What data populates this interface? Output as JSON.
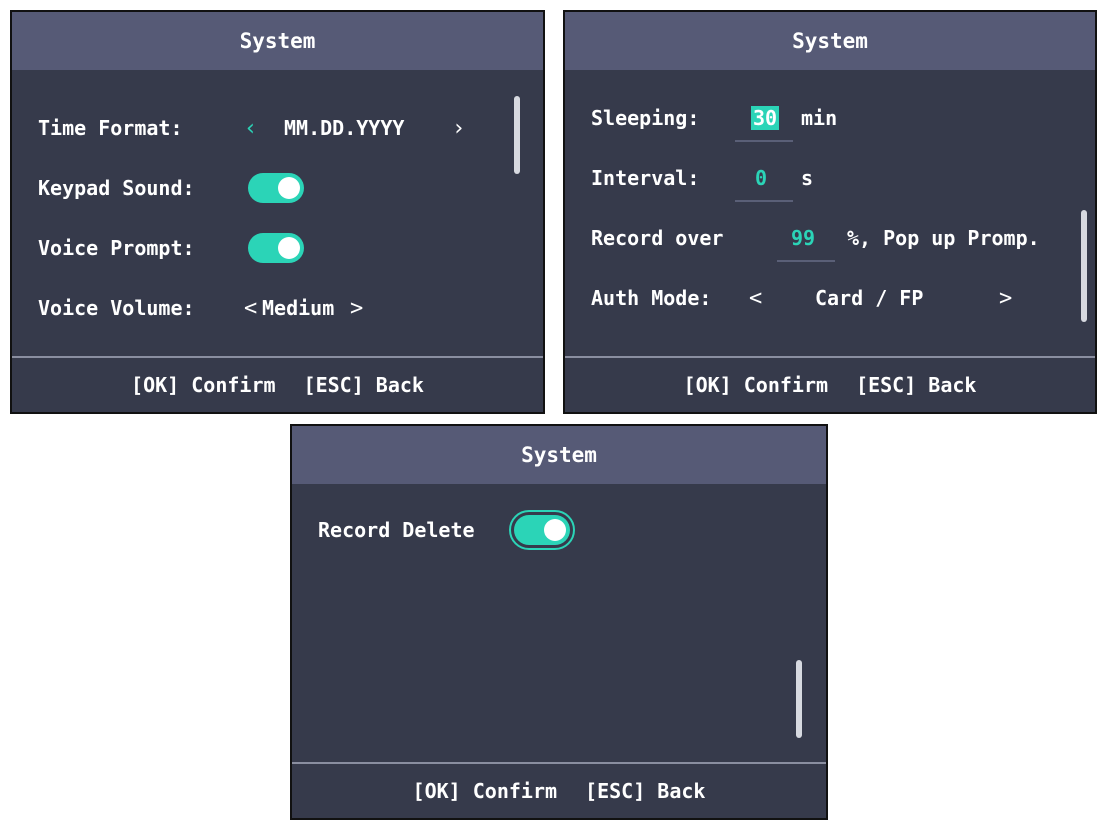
{
  "panel1": {
    "title": "System",
    "time_format_label": "Time Format:",
    "time_format_prev_icon": "chevron-left-icon",
    "time_format_value": "MM.DD.YYYY",
    "time_format_next_icon": "chevron-right-icon",
    "keypad_sound_label": "Keypad Sound:",
    "keypad_sound_on": true,
    "voice_prompt_label": "Voice Prompt:",
    "voice_prompt_on": true,
    "voice_volume_label": "Voice Volume:",
    "voice_volume_left": "<",
    "voice_volume_value": "Medium",
    "voice_volume_right": ">",
    "footer_ok": "[OK] Confirm",
    "footer_esc": "[ESC] Back"
  },
  "panel2": {
    "title": "System",
    "sleeping_label": "Sleeping:",
    "sleeping_value": "30",
    "sleeping_unit": "min",
    "interval_label": "Interval:",
    "interval_value": "0",
    "interval_unit": "s",
    "record_over_label": "Record over",
    "record_over_value": "99",
    "record_over_suffix": "%, Pop up Promp.",
    "auth_mode_label": "Auth Mode:",
    "auth_mode_left": "<",
    "auth_mode_value": "Card / FP",
    "auth_mode_right": ">",
    "footer_ok": "[OK] Confirm",
    "footer_esc": "[ESC] Back"
  },
  "panel3": {
    "title": "System",
    "record_delete_label": "Record Delete",
    "record_delete_on": true,
    "footer_ok": "[OK] Confirm",
    "footer_esc": "[ESC] Back"
  },
  "colors": {
    "background": "#363a4b",
    "titlebar": "#565a76",
    "accent": "#2bd4b7",
    "text": "#ffffff"
  }
}
